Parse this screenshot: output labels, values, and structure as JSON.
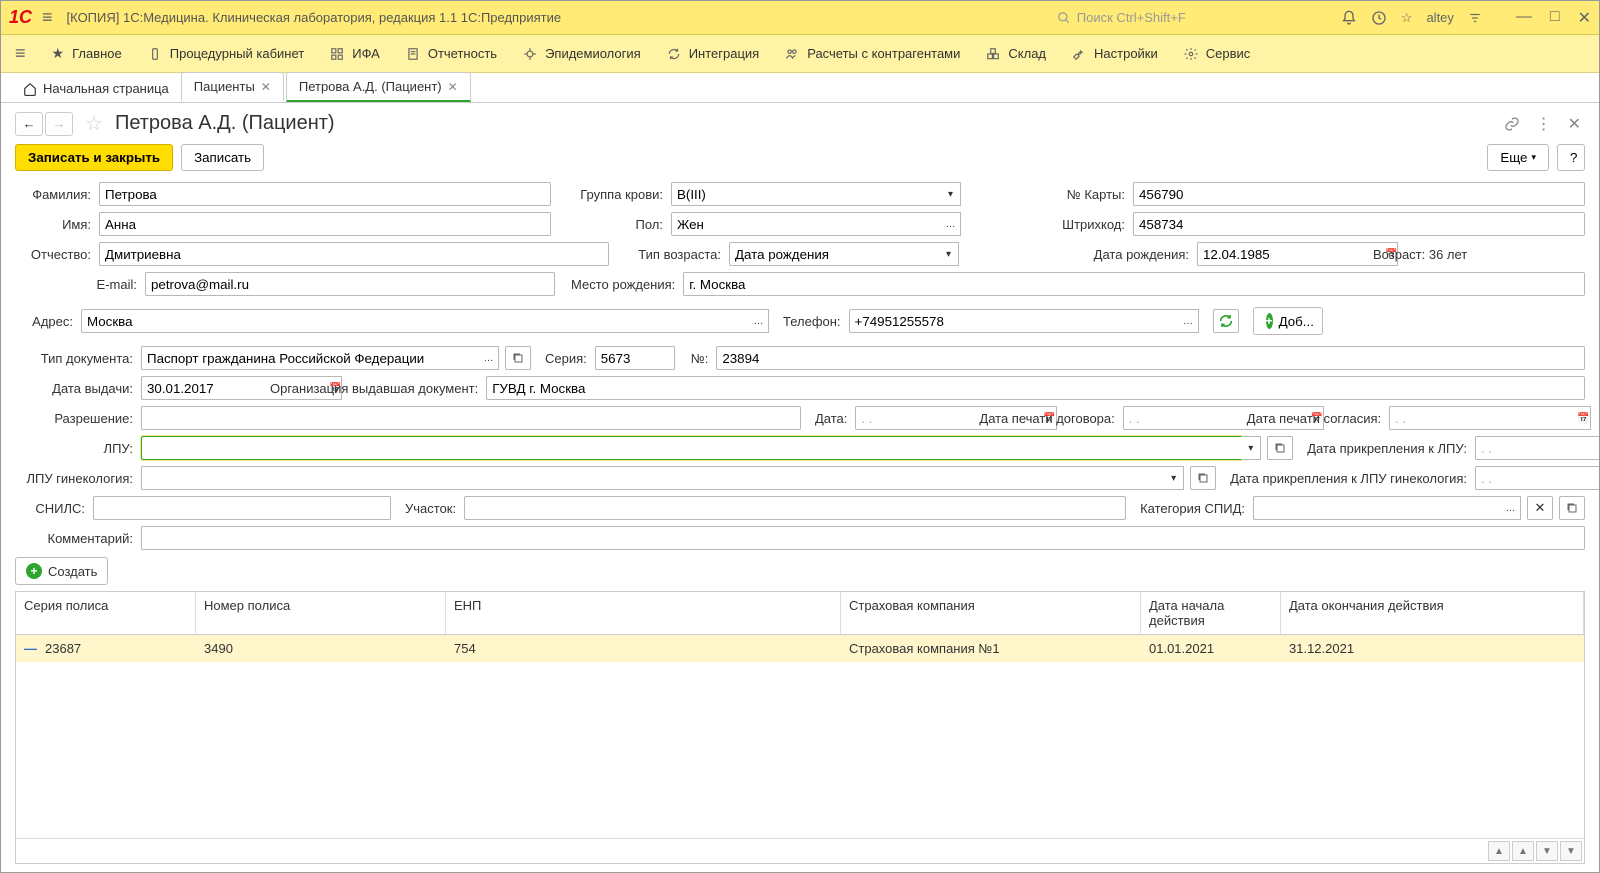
{
  "titlebar": {
    "title": "[КОПИЯ] 1С:Медицина. Клиническая лаборатория, редакция 1.1 1С:Предприятие",
    "search_placeholder": "Поиск Ctrl+Shift+F",
    "user": "altey"
  },
  "menu": {
    "items": [
      {
        "label": "Главное"
      },
      {
        "label": "Процедурный кабинет"
      },
      {
        "label": "ИФА"
      },
      {
        "label": "Отчетность"
      },
      {
        "label": "Эпидемиология"
      },
      {
        "label": "Интеграция"
      },
      {
        "label": "Расчеты с контрагентами"
      },
      {
        "label": "Склад"
      },
      {
        "label": "Настройки"
      },
      {
        "label": "Сервис"
      }
    ]
  },
  "tabs": {
    "home": "Начальная страница",
    "items": [
      {
        "label": "Пациенты",
        "active": false
      },
      {
        "label": "Петрова А.Д. (Пациент)",
        "active": true
      }
    ]
  },
  "page": {
    "title": "Петрова А.Д. (Пациент)"
  },
  "actions": {
    "save_close": "Записать и закрыть",
    "save": "Записать",
    "more": "Еще",
    "help": "?"
  },
  "labels": {
    "surname": "Фамилия:",
    "name": "Имя:",
    "patronymic": "Отчество:",
    "email": "E-mail:",
    "birthplace": "Место рождения:",
    "address": "Адрес:",
    "phone": "Телефон:",
    "add": "Доб...",
    "blood": "Группа крови:",
    "sex": "Пол:",
    "age_type": "Тип возраста:",
    "card_no": "№ Карты:",
    "barcode": "Штрихкод:",
    "dob": "Дата рождения:",
    "age": "Возраст: 36 лет",
    "doc_type": "Тип документа:",
    "series": "Серия:",
    "number": "№:",
    "issue_date": "Дата выдачи:",
    "issuer": "Организация выдавшая документ:",
    "permission": "Разрешение:",
    "date": "Дата:",
    "contract_print": "Дата печати договора:",
    "consent_print": "Дата печати согласия:",
    "lpu": "ЛПУ:",
    "lpu_date": "Дата прикрепления к ЛПУ:",
    "lpu_gyn": "ЛПУ гинекология:",
    "lpu_gyn_date": "Дата прикрепления к ЛПУ гинекология:",
    "snils": "СНИЛС:",
    "area": "Участок:",
    "aids_cat": "Категория СПИД:",
    "comment": "Комментарий:",
    "create": "Создать"
  },
  "values": {
    "surname": "Петрова",
    "name": "Анна",
    "patronymic": "Дмитриевна",
    "email": "petrova@mail.ru",
    "birthplace": "г. Москва",
    "address": "Москва",
    "phone": "+74951255578",
    "blood": "B(III)",
    "sex": "Жен",
    "age_type": "Дата рождения",
    "card_no": "456790",
    "barcode": "458734",
    "dob": "12.04.1985",
    "doc_type": "Паспорт гражданина Российской Федерации",
    "series": "5673",
    "number": "23894",
    "issue_date": "30.01.2017",
    "issuer": "ГУВД г. Москва",
    "permission": "",
    "lpu": "",
    "lpu_gyn": "",
    "snils": "",
    "area": "",
    "aids_cat": "",
    "comment": "",
    "date_ph": ". ."
  },
  "table": {
    "headers": [
      "Серия полиса",
      "Номер полиса",
      "ЕНП",
      "Страховая компания",
      "Дата начала действия",
      "Дата окончания действия"
    ],
    "rows": [
      {
        "series": "23687",
        "number": "3490",
        "enp": "754",
        "company": "Страховая компания №1",
        "start": "01.01.2021",
        "end": "31.12.2021"
      }
    ]
  }
}
